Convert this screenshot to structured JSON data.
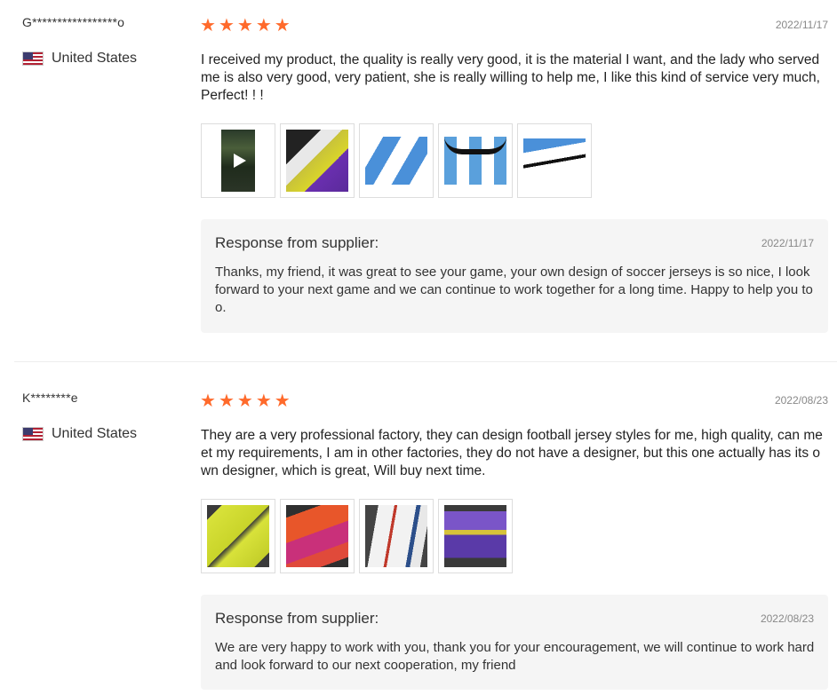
{
  "reviews": [
    {
      "user": "G*****************o",
      "country": "United States",
      "rating": 5,
      "date": "2022/11/17",
      "text": "I received my product, the quality is really very good, it is the material I want, and the lady who served me is also very good, very patient, she is really willing to help me, I like this kind of service very much, Perfect! ! !",
      "thumbnails": [
        "video-thumbnail",
        "jersey-photo",
        "jersey-fabric-photo",
        "jersey-collar-photo",
        "jersey-sleeve-photo"
      ],
      "response": {
        "title": "Response from supplier:",
        "date": "2022/11/17",
        "text": "Thanks, my friend, it was great to see your game, your own design of soccer jerseys is so nice, I look forward to your next game and we can continue to work together for a long time. Happy to help you too."
      }
    },
    {
      "user": "K********e",
      "country": "United States",
      "rating": 5,
      "date": "2022/08/23",
      "text": "They are a very professional factory, they can design football jersey styles for me, high quality, can meet my requirements, I am in other factories, they do not have a designer, but this one actually has its own designer, which is great, Will buy next time.",
      "thumbnails": [
        "yellow-kit-photo",
        "orange-kit-photo",
        "white-kit-photo",
        "purple-kit-photo"
      ],
      "response": {
        "title": "Response from supplier:",
        "date": "2022/08/23",
        "text": "We are very happy to work with you, thank you for your encouragement, we will continue to work hard and look forward to our next cooperation, my friend"
      }
    }
  ],
  "colors": {
    "star": "#ff6a2b",
    "response_bg": "#f5f5f5"
  }
}
